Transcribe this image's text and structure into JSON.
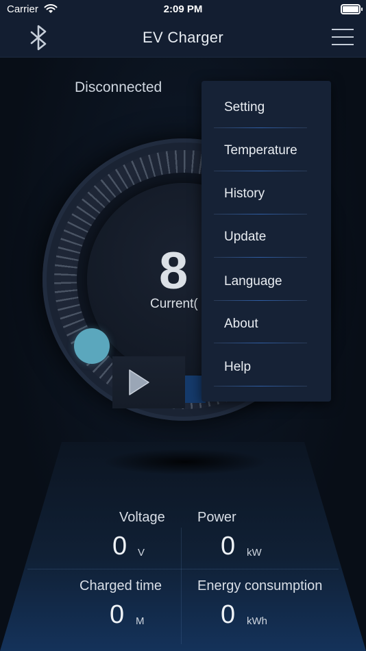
{
  "status_bar": {
    "carrier": "Carrier",
    "time": "2:09 PM"
  },
  "header": {
    "title": "EV Charger",
    "left_icon": "bluetooth-icon",
    "right_icon": "hamburger-menu-icon"
  },
  "connection": {
    "status": "Disconnected"
  },
  "gauge": {
    "value": "8",
    "label": "Current("
  },
  "stats": {
    "voltage": {
      "label": "Voltage",
      "value": "0",
      "unit": "V"
    },
    "power": {
      "label": "Power",
      "value": "0",
      "unit": "kW"
    },
    "charged_time": {
      "label": "Charged time",
      "value": "0",
      "unit": "M"
    },
    "energy": {
      "label": "Energy consumption",
      "value": "0",
      "unit": "kWh"
    }
  },
  "menu": {
    "items": [
      {
        "label": "Setting"
      },
      {
        "label": "Temperature"
      },
      {
        "label": "History"
      },
      {
        "label": "Update"
      },
      {
        "label": "Language"
      },
      {
        "label": "About"
      },
      {
        "label": "Help"
      }
    ]
  },
  "colors": {
    "header_bg": "#131e31",
    "accent_teal": "#5ba7bd",
    "menu_bg": "#162236",
    "separator_blue": "#2f5fa8"
  }
}
